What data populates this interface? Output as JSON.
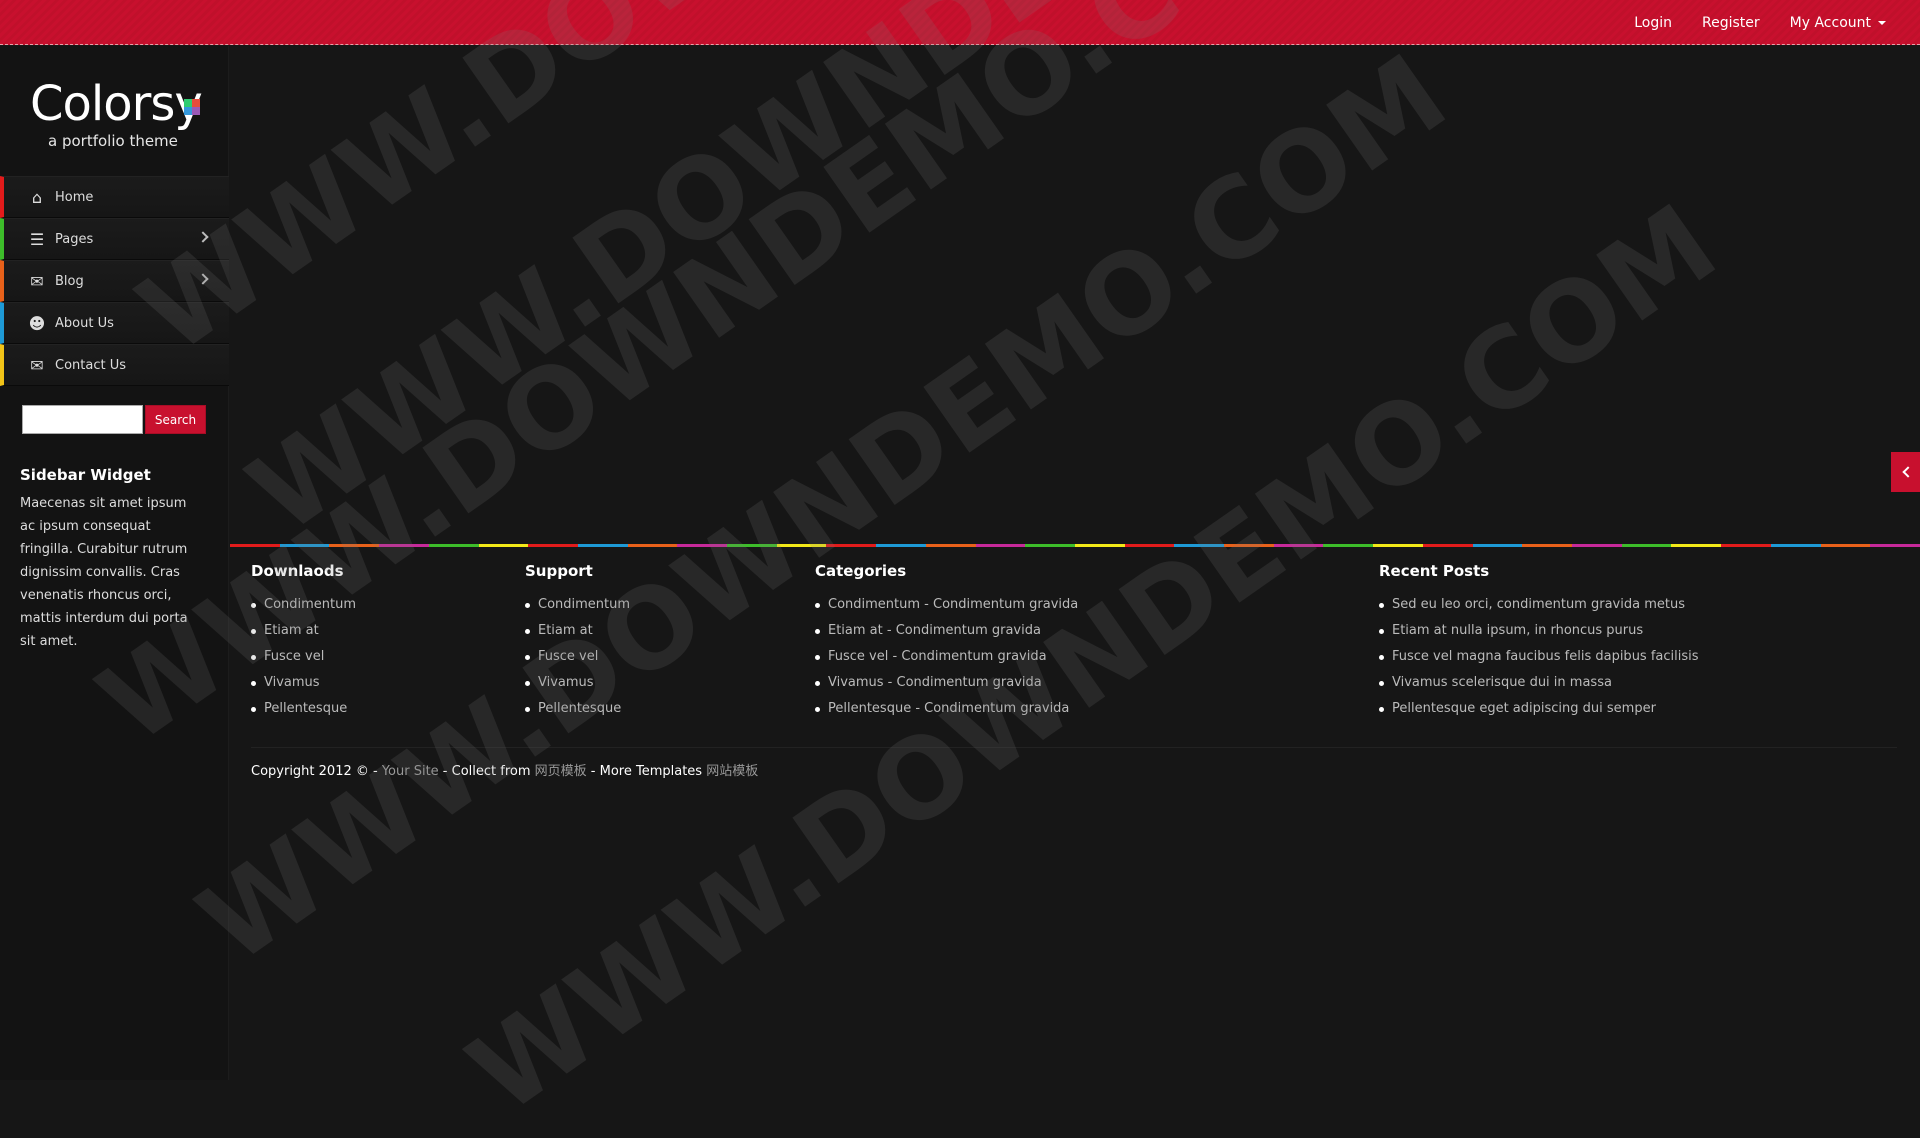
{
  "topnav": {
    "login": "Login",
    "register": "Register",
    "account": "My Account"
  },
  "logo": {
    "name": "Colorsy",
    "tagline": "a portfolio theme",
    "square_colors": [
      "#2ecc71",
      "#e74c3c",
      "#3498db",
      "#9b59b6"
    ]
  },
  "sidebar_menu": [
    {
      "label": "Home",
      "icon": "home-icon",
      "accent": "#e21b1b",
      "submenu": false
    },
    {
      "label": "Pages",
      "icon": "list-icon",
      "accent": "#3dbd2a",
      "submenu": true
    },
    {
      "label": "Blog",
      "icon": "comments-icon",
      "accent": "#e8611a",
      "submenu": true
    },
    {
      "label": "About Us",
      "icon": "user-icon",
      "accent": "#1e9ad6",
      "submenu": false
    },
    {
      "label": "Contact Us",
      "icon": "envelope-icon",
      "accent": "#f2c418",
      "submenu": false
    }
  ],
  "search": {
    "value": "",
    "button_label": "Search"
  },
  "widget": {
    "title": "Sidebar Widget",
    "text": "Maecenas sit amet ipsum ac ipsum consequat fringilla. Curabitur rutrum dignissim convallis. Cras venenatis rhoncus orci, mattis interdum dui porta sit amet."
  },
  "rainbow_colors": [
    "#e21b1b",
    "#1e9ad6",
    "#e8611a",
    "#c7299a",
    "#3dbd2a",
    "#f2e818",
    "#e21b1b",
    "#1e9ad6",
    "#e8611a",
    "#c7299a",
    "#3dbd2a",
    "#f2e818",
    "#e21b1b",
    "#1e9ad6",
    "#e8611a",
    "#c7299a",
    "#3dbd2a",
    "#f2e818",
    "#e21b1b",
    "#1e9ad6",
    "#e8611a",
    "#c7299a",
    "#3dbd2a",
    "#f2e818",
    "#e21b1b",
    "#1e9ad6",
    "#e8611a",
    "#c7299a",
    "#3dbd2a",
    "#f2e818",
    "#e21b1b",
    "#1e9ad6",
    "#e8611a",
    "#c7299a"
  ],
  "footer": {
    "downloads": {
      "title": "Downlaods",
      "items": [
        "Condimentum",
        "Etiam at",
        "Fusce vel",
        "Vivamus",
        "Pellentesque"
      ]
    },
    "support": {
      "title": "Support",
      "items": [
        "Condimentum",
        "Etiam at",
        "Fusce vel",
        "Vivamus",
        "Pellentesque"
      ]
    },
    "categories": {
      "title": "Categories",
      "items": [
        "Condimentum - Condimentum gravida",
        "Etiam at - Condimentum gravida",
        "Fusce vel - Condimentum gravida",
        "Vivamus - Condimentum gravida",
        "Pellentesque - Condimentum gravida"
      ]
    },
    "recent_posts": {
      "title": "Recent Posts",
      "items": [
        "Sed eu leo orci, condimentum gravida metus",
        "Etiam at nulla ipsum, in rhoncus purus",
        "Fusce vel magna faucibus felis dapibus facilisis",
        "Vivamus scelerisque dui in massa",
        "Pellentesque eget adipiscing dui semper"
      ]
    }
  },
  "copyright": {
    "prefix": "Copyright 2012 © - ",
    "site": "Your Site",
    "collect": " - Collect from ",
    "collect_link": "网页模板",
    "more": " - More Templates ",
    "more_link": "网站模板"
  },
  "watermark": "WWW.DOWNDEMO.COM"
}
